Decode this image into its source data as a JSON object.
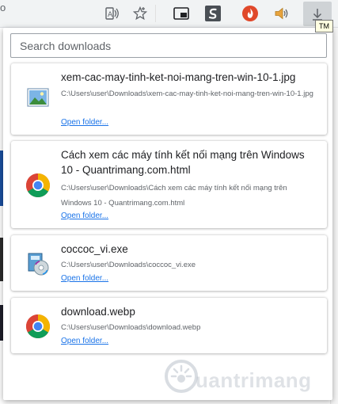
{
  "toolbar": {
    "left_fragment": "o",
    "tooltip": "TM"
  },
  "search": {
    "placeholder": "Search downloads"
  },
  "downloads": [
    {
      "name": "xem-cac-may-tinh-ket-noi-mang-tren-win-10-1.jpg",
      "path": "C:\\Users\\user\\Downloads\\xem-cac-may-tinh-ket-noi-mang-tren-win-10-1.jpg",
      "link": "Open folder...",
      "icon": "image-file-icon"
    },
    {
      "name": "Cách xem các máy tính kết nối mạng trên Windows 10 - Quantrimang.com.html",
      "path": "C:\\Users\\user\\Downloads\\Cách xem các máy tính kết nối mạng trên Windows 10 - Quantrimang.com.html",
      "link": "Open folder...",
      "icon": "chrome-icon"
    },
    {
      "name": "coccoc_vi.exe",
      "path": "C:\\Users\\user\\Downloads\\coccoc_vi.exe",
      "link": "Open folder...",
      "icon": "installer-icon"
    },
    {
      "name": "download.webp",
      "path": "C:\\Users\\user\\Downloads\\download.webp",
      "link": "Open folder...",
      "icon": "chrome-icon"
    }
  ],
  "watermark": {
    "text": "uantrimang"
  },
  "colors": {
    "link": "#1a73e8",
    "toolbar": "#f1f3f4",
    "active_button": "#cfd3d6"
  }
}
